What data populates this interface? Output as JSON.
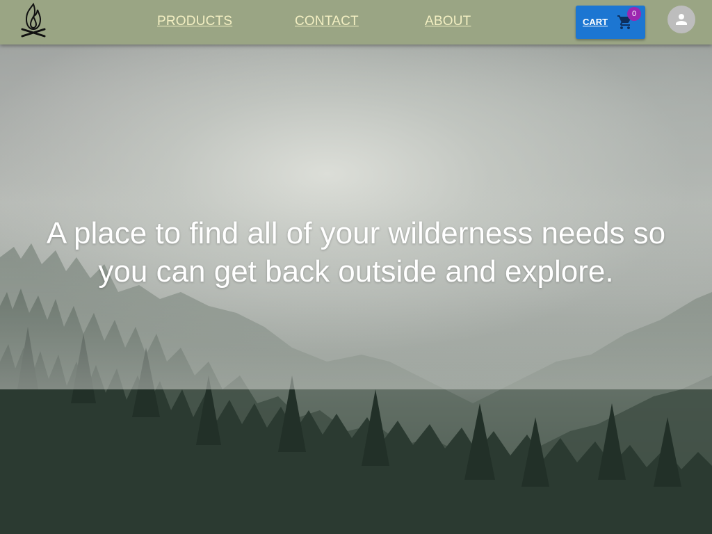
{
  "navbar": {
    "logo_icon": "campfire-icon",
    "links": {
      "products": "PRODUCTS",
      "contact": "CONTACT",
      "about": "ABOUT"
    },
    "cart": {
      "label": "CART",
      "icon": "shopping-cart-icon",
      "count": "0"
    },
    "avatar_icon": "person-icon"
  },
  "hero": {
    "tagline": "A place to find all of your wilderness needs so you can get back outside and explore.",
    "background": "misty-pine-forest-photo"
  },
  "colors": {
    "navbar_bg": "#9aa584",
    "nav_link": "#f3efc2",
    "cart_button": "#1c76d2",
    "cart_badge": "#9c27b0",
    "avatar_bg": "#bdbdbd",
    "tagline": "#ffffff"
  }
}
